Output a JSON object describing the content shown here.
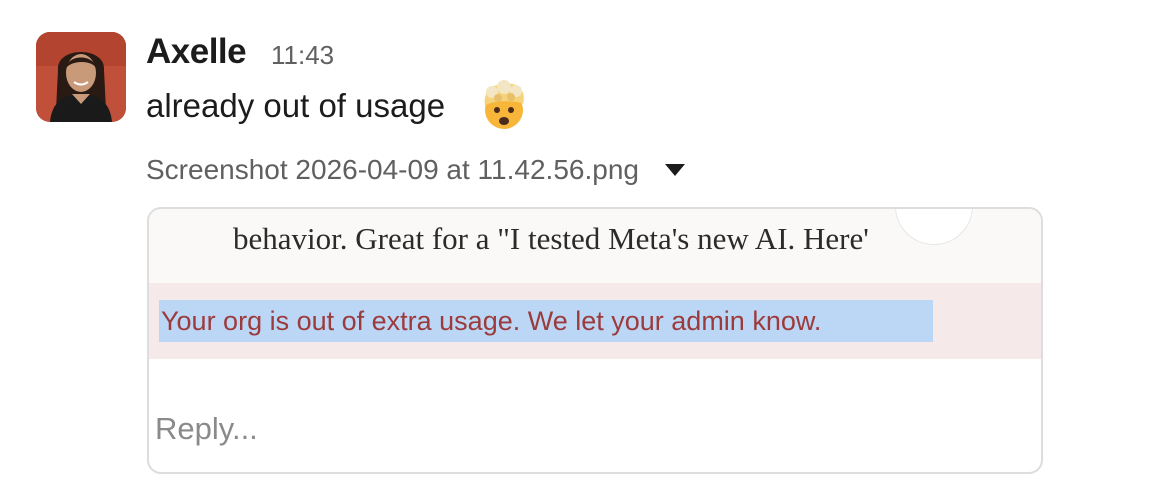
{
  "message": {
    "author": "Axelle",
    "timestamp": "11:43",
    "text": "already out of usage",
    "emoji": "exploding-head-emoji",
    "avatar_bg": "#c0503a"
  },
  "attachment": {
    "filename": "Screenshot 2026-04-09 at 11.42.56.png",
    "caret_icon": "caret-down-icon"
  },
  "preview": {
    "top_text": "behavior. Great for a \"I tested Meta's new AI. Here'",
    "error_text": "Your org is out of extra usage. We let your admin know.",
    "reply_placeholder": "Reply...",
    "error_color": "#9b3b3b",
    "highlight_color": "#bcd6f5",
    "band_color": "#f5e9e9"
  }
}
